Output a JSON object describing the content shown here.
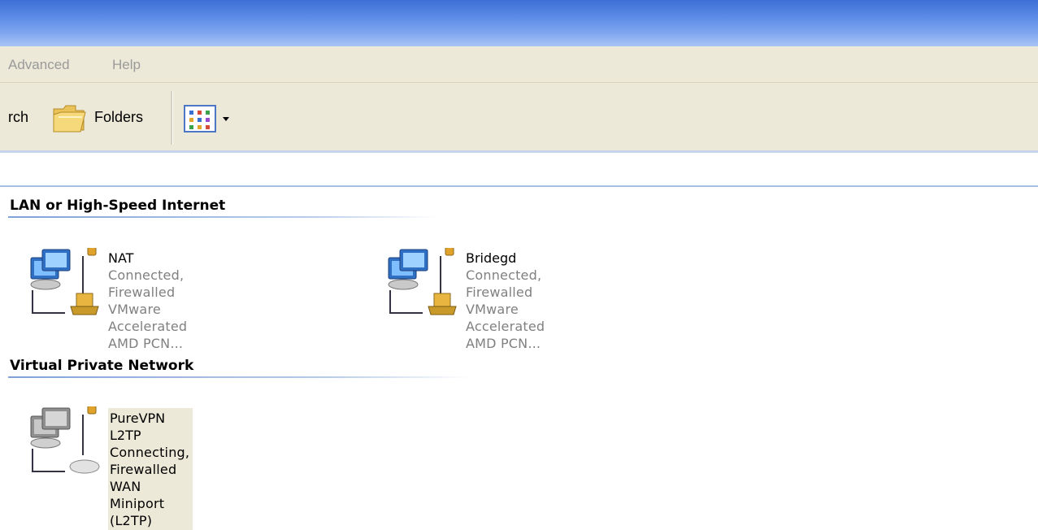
{
  "menubar": {
    "items": [
      "Advanced",
      "Help"
    ]
  },
  "toolbar": {
    "search_label": "rch",
    "folders_label": "Folders",
    "views_icon": "views-icon"
  },
  "groups": [
    {
      "title": "LAN or High-Speed Internet",
      "connections": [
        {
          "name": "NAT",
          "status": "Connected, Firewalled",
          "device": "VMware Accelerated AMD PCN...",
          "icon": "network-connection-icon"
        },
        {
          "name": "Bridegd",
          "status": "Connected, Firewalled",
          "device": "VMware Accelerated AMD PCN...",
          "icon": "network-connection-icon"
        }
      ]
    },
    {
      "title": "Virtual Private Network",
      "connections": [
        {
          "name": "PureVPN L2TP",
          "status": "Connecting, Firewalled",
          "device": "WAN Miniport (L2TP)",
          "icon": "vpn-connection-icon"
        }
      ]
    }
  ],
  "colors": {
    "titlebar": "#3d6fd6",
    "menubar": "#ece9d8",
    "status_text": "#808080",
    "selected_bg": "#ece9d8"
  }
}
